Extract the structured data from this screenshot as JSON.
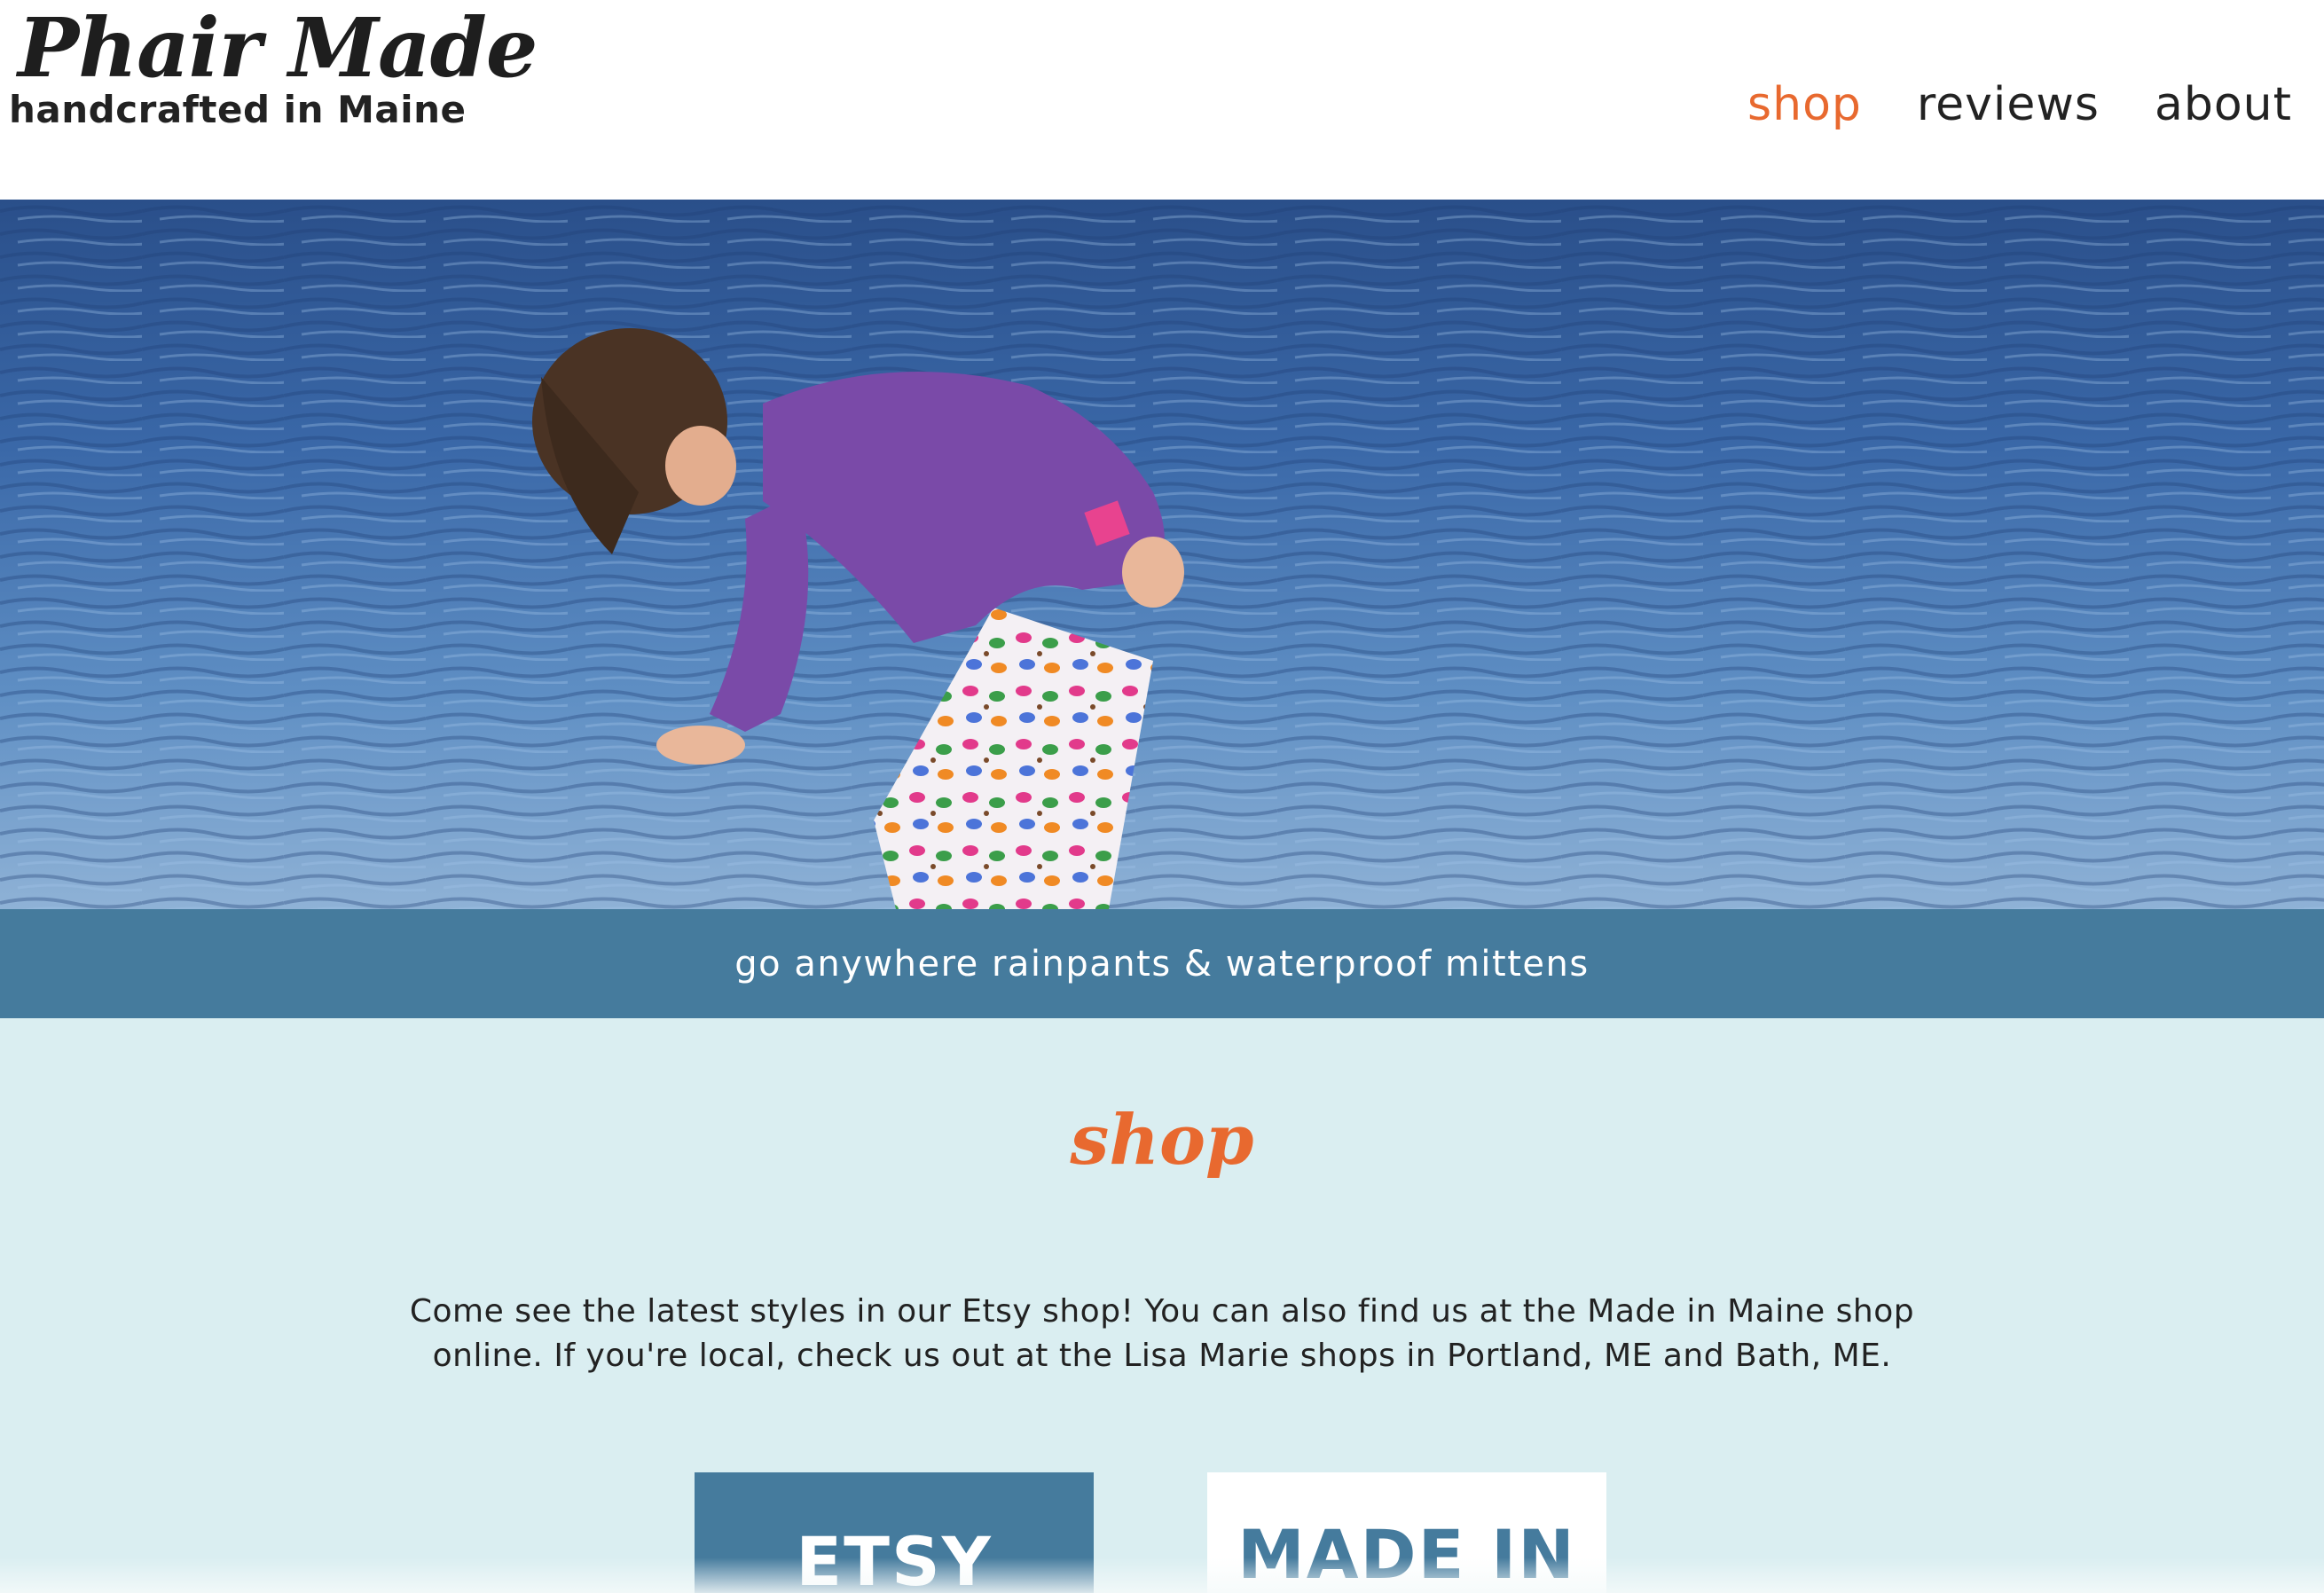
{
  "header": {
    "brand_title": "Phair Made",
    "brand_tagline": "handcrafted in Maine",
    "nav": [
      {
        "label": "shop",
        "active": true
      },
      {
        "label": "reviews",
        "active": false
      },
      {
        "label": "about",
        "active": false
      }
    ]
  },
  "hero": {
    "banner_text": "go anywhere rainpants & waterproof mittens"
  },
  "shop": {
    "heading": "shop",
    "description": "Come see the latest styles in our Etsy shop! You can also find us at the Made in Maine shop online. If you're local, check us out at the Lisa Marie shops in Portland, ME and Bath, ME.",
    "cards": [
      {
        "label": "ETSY"
      },
      {
        "label": "MADE IN"
      }
    ]
  },
  "colors": {
    "accent": "#e8692f",
    "banner": "#457b9d",
    "section_bg": "#daeef1",
    "text": "#222222"
  }
}
